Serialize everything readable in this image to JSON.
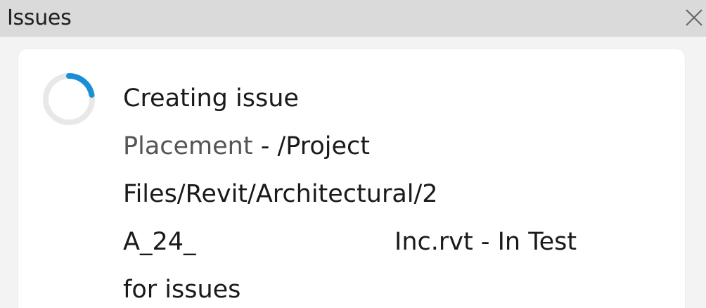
{
  "window": {
    "title": "Issues"
  },
  "issue": {
    "status": "Creating issue",
    "placement_label": "Placement",
    "placement_separator": " - /Project",
    "path_line": "Files/Revit/Architectural/2",
    "file_prefix": "A_24_",
    "file_suffix": "Inc.rvt - In Test",
    "last_line": "for issues"
  },
  "colors": {
    "spinner_track": "#e6e6e6",
    "spinner_arc": "#1a8fd6"
  },
  "icons": {
    "close": "close-icon",
    "spinner": "loading-spinner-icon"
  }
}
